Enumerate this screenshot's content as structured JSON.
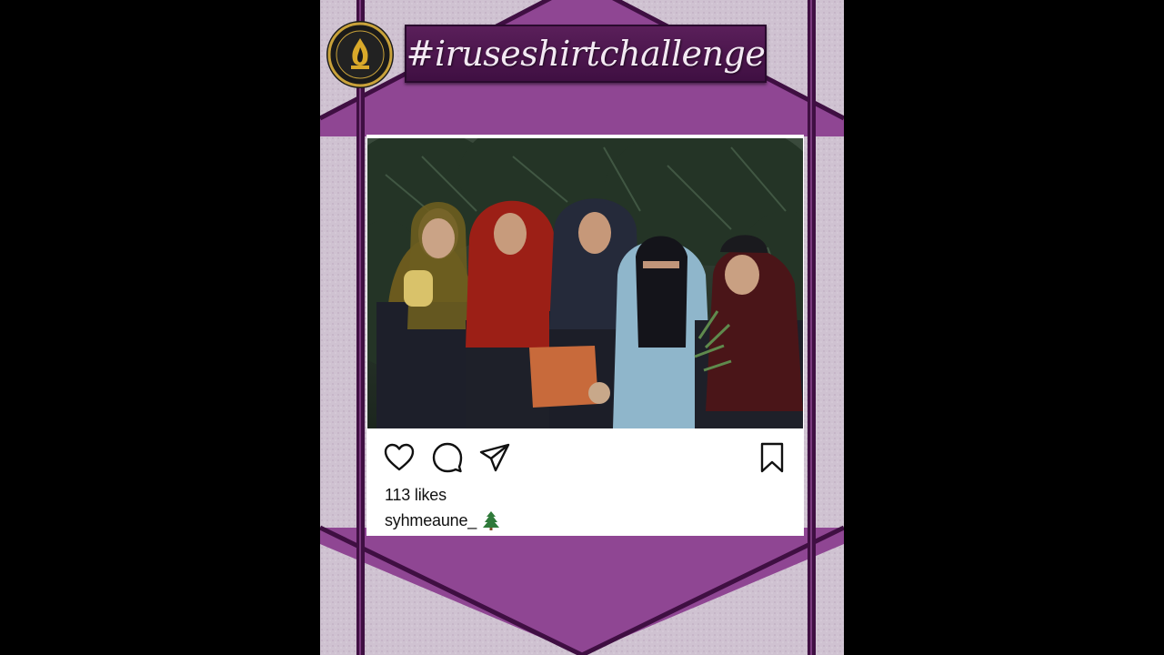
{
  "hashtag": "#iruseshirtchallenge",
  "logo": {
    "icon": "golden-emblem-icon"
  },
  "post": {
    "likes_text": "113 likes",
    "username": "syhmeaune_",
    "caption_emoji": "tree-emoji",
    "actions": {
      "like": "heart-icon",
      "comment": "comment-bubble-icon",
      "share": "paper-plane-icon",
      "save": "bookmark-icon"
    }
  },
  "colors": {
    "frame_purple": "#8f4693",
    "frame_dark": "#3f0f42",
    "panel_light": "#cdbfcf",
    "card_bg": "#ffffff",
    "letterbox": "#000000"
  }
}
